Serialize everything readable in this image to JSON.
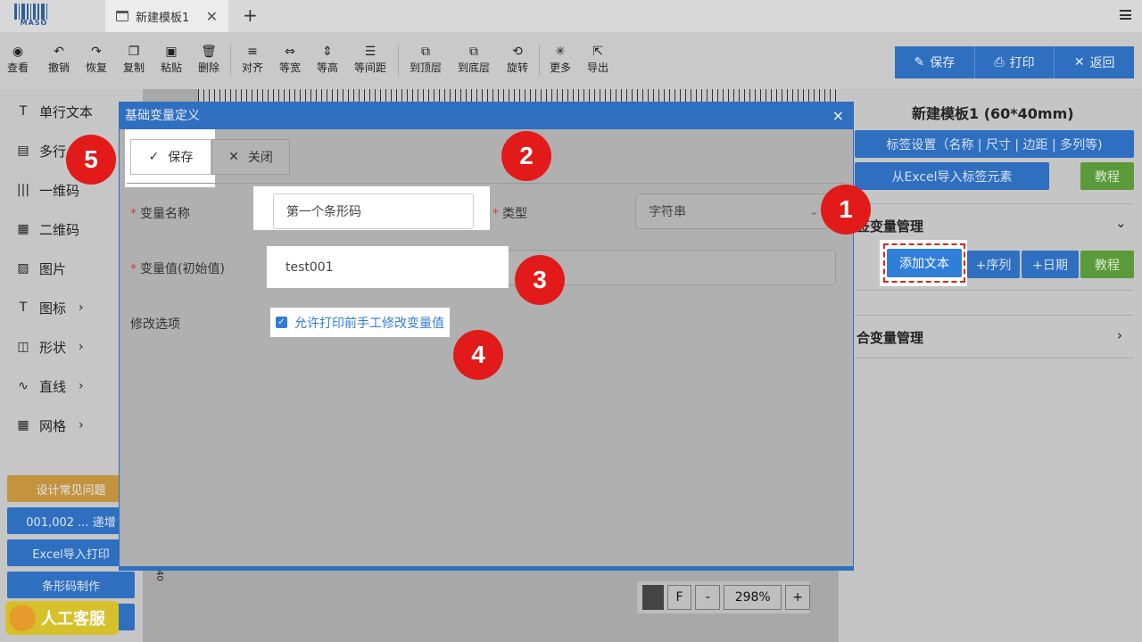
{
  "tabbar": {
    "logo_text": "MASO",
    "tab_label": "新建模板1",
    "tab_close": "✕",
    "new_tab": "+"
  },
  "toolbar": {
    "tools": [
      {
        "label": "查看",
        "icon": "eye-icon"
      },
      {
        "label": "撤销",
        "icon": "undo-icon"
      },
      {
        "label": "恢复",
        "icon": "redo-icon"
      },
      {
        "label": "复制",
        "icon": "copy-icon"
      },
      {
        "label": "粘贴",
        "icon": "paste-icon"
      },
      {
        "label": "删除",
        "icon": "trash-icon"
      },
      {
        "label": "对齐",
        "icon": "align-icon"
      },
      {
        "label": "等宽",
        "icon": "equal-width-icon"
      },
      {
        "label": "等高",
        "icon": "equal-height-icon"
      },
      {
        "label": "等间距",
        "icon": "equal-spacing-icon"
      },
      {
        "label": "到顶层",
        "icon": "bring-front-icon"
      },
      {
        "label": "到底层",
        "icon": "send-back-icon"
      },
      {
        "label": "旋转",
        "icon": "rotate-icon"
      },
      {
        "label": "更多",
        "icon": "more-icon"
      },
      {
        "label": "导出",
        "icon": "export-icon"
      }
    ],
    "save_label": "保存",
    "print_label": "打印",
    "back_label": "返回"
  },
  "sidebar": {
    "items": [
      {
        "label": "单行文本",
        "icon": "T"
      },
      {
        "label": "多行",
        "icon": "▤"
      },
      {
        "label": "一维码",
        "icon": "|||"
      },
      {
        "label": "二维码",
        "icon": "▦"
      },
      {
        "label": "图片",
        "icon": "▨"
      },
      {
        "label": "图标",
        "icon": "T",
        "arrow": "›"
      },
      {
        "label": "形状",
        "icon": "◫",
        "arrow": "›"
      },
      {
        "label": "直线",
        "icon": "∿",
        "arrow": "›"
      },
      {
        "label": "网格",
        "icon": "▦",
        "arrow": "›"
      }
    ],
    "buttons": [
      {
        "label": "设计常见问题"
      },
      {
        "label": "001,002 ... 递增"
      },
      {
        "label": "Excel导入打印"
      },
      {
        "label": "条形码制作"
      }
    ],
    "kefu_label": "人工客服"
  },
  "canvas": {
    "zoom_f": "F",
    "zoom_minus": "-",
    "zoom_value": "298%",
    "zoom_plus": "+",
    "ruler_value": "40"
  },
  "right_panel": {
    "title": "新建模板1 (60*40mm)",
    "label_settings": "标签设置（名称 | 尺寸 | 边距 | 多列等)",
    "excel_import": "从Excel导入标签元素",
    "tutorial": "教程",
    "var_section": "签变量管理",
    "add_text": "添加文本",
    "add_seq": "+序列",
    "add_date": "+日期",
    "tutorial2": "教程",
    "combo_section": "合变量管理"
  },
  "modal": {
    "title": "基础变量定义",
    "close_x": "×",
    "save_label": "保存",
    "close_label": "关闭",
    "var_name_label": "变量名称",
    "var_name_value": "第一个条形码",
    "type_label": "类型",
    "type_value": "字符串",
    "var_value_label": "变量值(初始值)",
    "var_value_value": "test001",
    "options_label": "修改选项",
    "allow_edit_label": "允许打印前手工修改变量值",
    "allow_edit_checked": true
  },
  "badges": [
    "1",
    "2",
    "3",
    "4",
    "5"
  ],
  "colors": {
    "primary": "#2f6fbf",
    "green": "#5a9a3a",
    "orange": "#d4973a",
    "badge_red": "#e21a1a"
  }
}
